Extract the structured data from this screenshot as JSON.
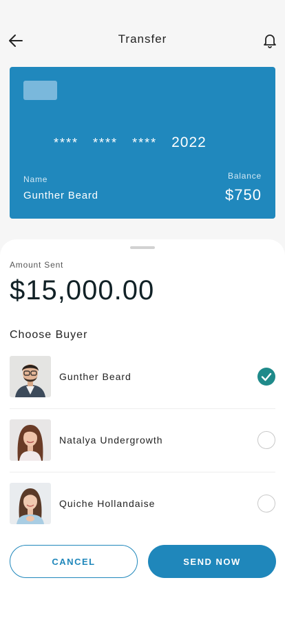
{
  "header": {
    "title": "Transfer",
    "back_icon": "arrow-left-icon",
    "notification_icon": "bell-icon"
  },
  "card": {
    "number_groups": [
      "****",
      "****",
      "****",
      "2022"
    ],
    "name_label": "Name",
    "name": "Gunther Beard",
    "balance_label": "Balance",
    "balance": "$750",
    "color": "#2088bd"
  },
  "amount": {
    "label": "Amount Sent",
    "value": "$15,000.00"
  },
  "buyers": {
    "heading": "Choose Buyer",
    "items": [
      {
        "name": "Gunther Beard",
        "selected": true
      },
      {
        "name": "Natalya Undergrowth",
        "selected": false
      },
      {
        "name": "Quiche Hollandaise",
        "selected": false
      }
    ]
  },
  "actions": {
    "cancel_label": "CANCEL",
    "send_label": "SEND NOW",
    "accent": "#1f87bb"
  }
}
